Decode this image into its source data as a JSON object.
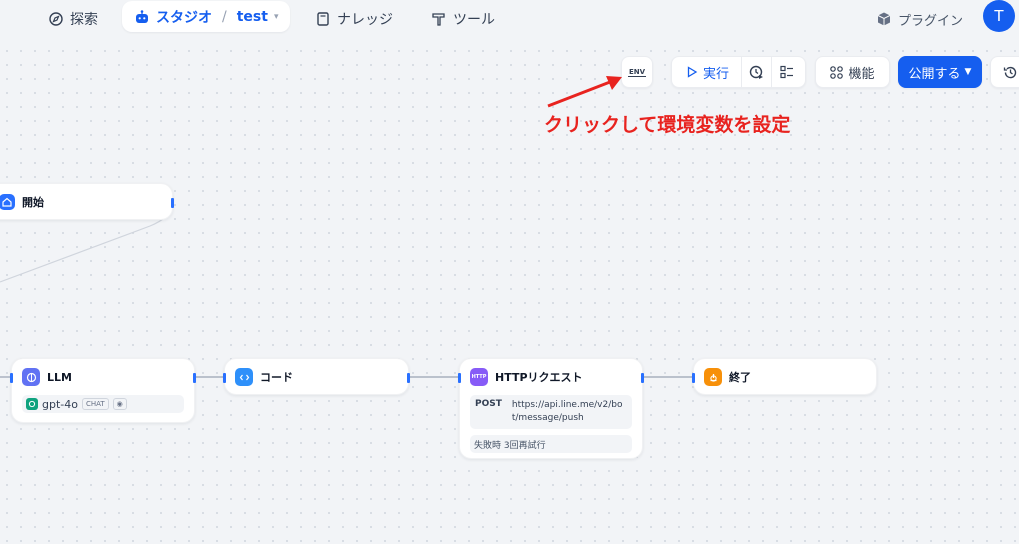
{
  "topnav": {
    "explore": "探索",
    "studio": "スタジオ",
    "app_name": "test",
    "knowledge": "ナレッジ",
    "tools": "ツール",
    "plugins": "プラグイン",
    "avatar": "T"
  },
  "toolbar": {
    "env": "ENV",
    "run": "実行",
    "features": "機能",
    "publish": "公開する"
  },
  "annotation": "クリックして環境変数を設定",
  "nodes": {
    "start": {
      "label": "開始"
    },
    "llm": {
      "label": "LLM",
      "model": "gpt-4o",
      "mode_tag": "CHAT"
    },
    "code": {
      "label": "コード"
    },
    "http": {
      "label": "HTTPリクエスト",
      "method": "POST",
      "url": "https://api.line.me/v2/bot/message/push",
      "retry": "失敗時 3回再試行",
      "icon_text": "HTTP"
    },
    "end": {
      "label": "終了"
    }
  },
  "colors": {
    "brand": "#155eef",
    "annotation": "#e8231f",
    "code_icon": "#2e90fa",
    "http_icon": "#875bf7",
    "end_icon": "#f79009",
    "llm_icon": "#6172f3",
    "start_icon": "#2970ff"
  }
}
